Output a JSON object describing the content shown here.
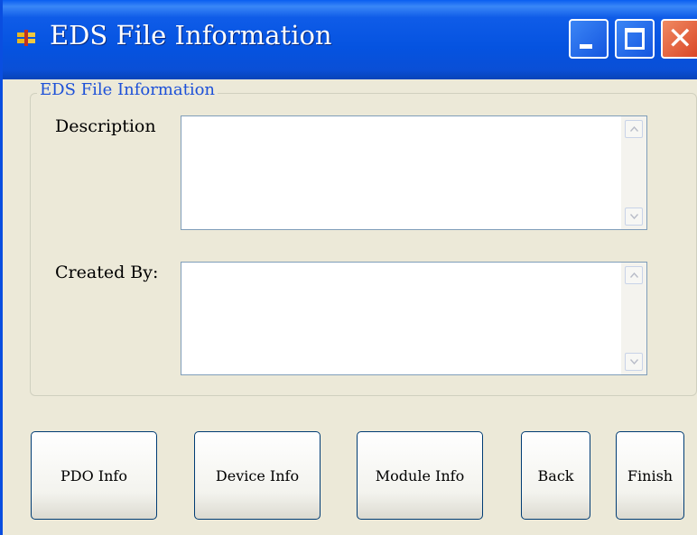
{
  "window": {
    "title": "EDS File Information",
    "controls": [
      "minimize-icon",
      "maximize-icon",
      "close-icon"
    ]
  },
  "group": {
    "label": "EDS File Information",
    "fields": [
      {
        "label": "Description",
        "value": ""
      },
      {
        "label": "Created By:",
        "value": ""
      }
    ]
  },
  "buttons": {
    "pdo_info": "PDO Info",
    "device_info": "Device Info",
    "module_info": "Module Info",
    "back": "Back",
    "finish": "Finish"
  },
  "colors": {
    "titlebar": "#0553e0",
    "window_bg": "#ece9d8",
    "group_label": "#1c50d8",
    "close_button": "#d94425"
  }
}
